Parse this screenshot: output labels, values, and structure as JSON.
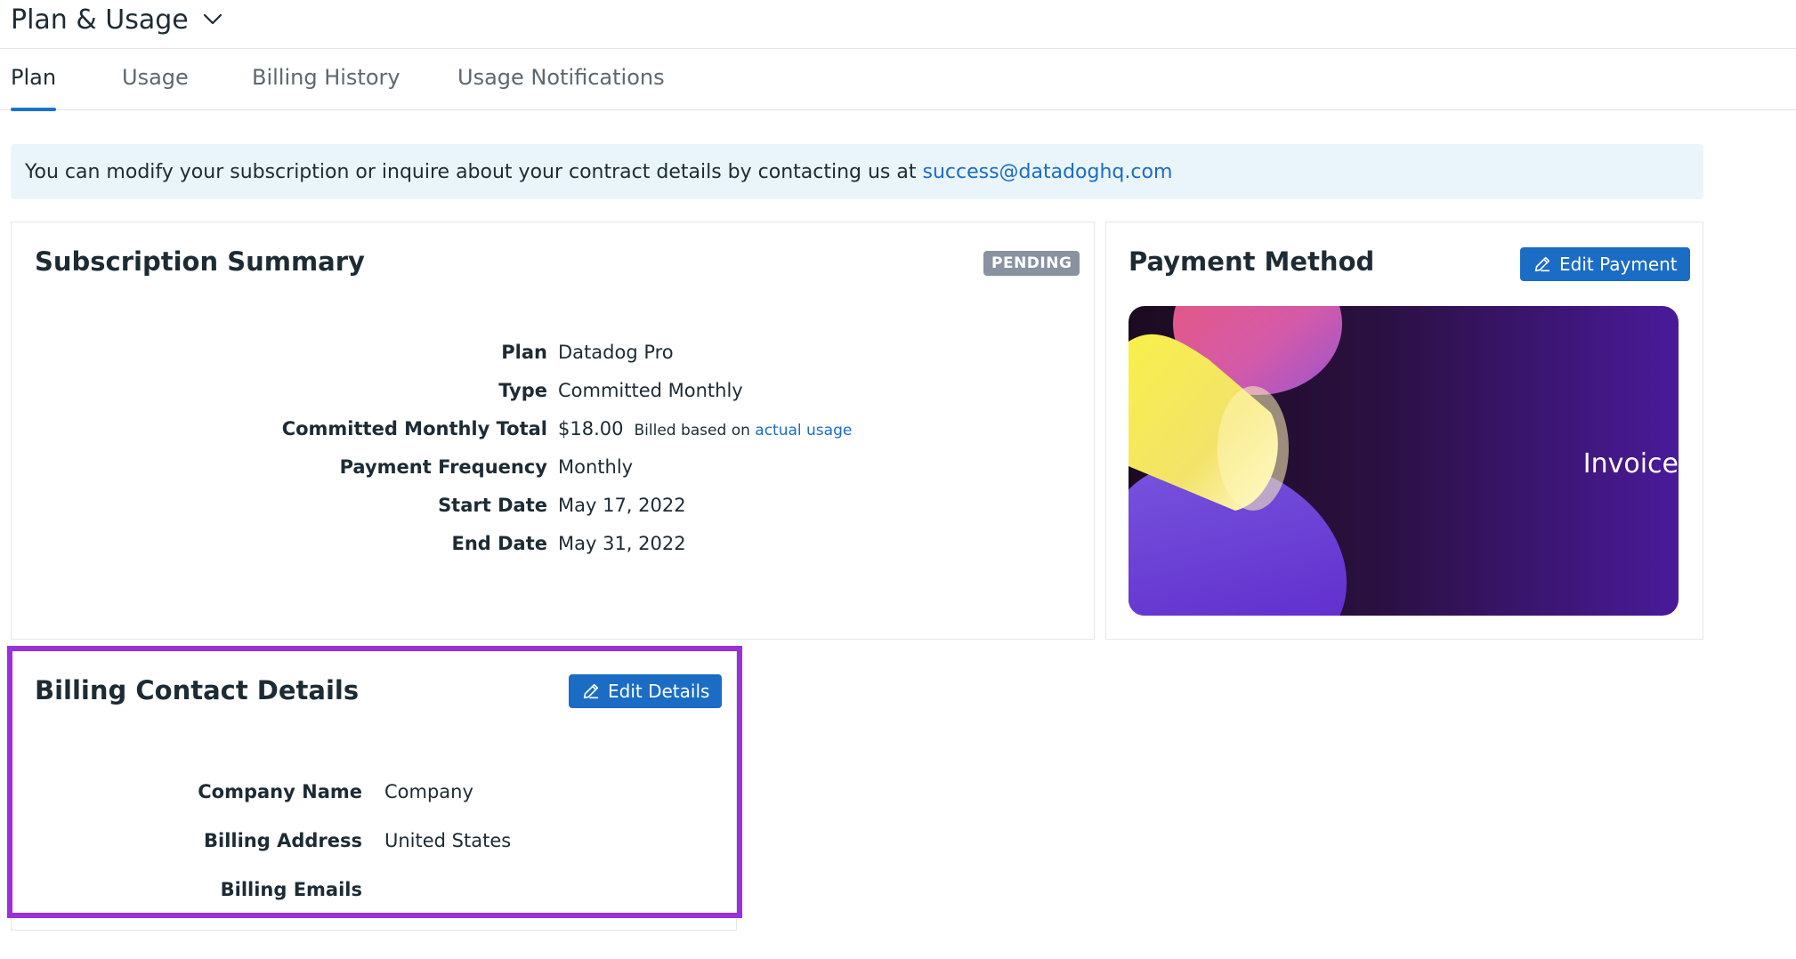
{
  "header": {
    "title": "Plan & Usage",
    "title_dropdown_icon": "chevron-down-icon"
  },
  "tabs": [
    {
      "label": "Plan",
      "active": true
    },
    {
      "label": "Usage",
      "active": false
    },
    {
      "label": "Billing History",
      "active": false
    },
    {
      "label": "Usage Notifications",
      "active": false
    }
  ],
  "banner": {
    "text": "You can modify your subscription or inquire about your contract details by contacting us at",
    "email": "success@datadoghq.com"
  },
  "subscription": {
    "title": "Subscription Summary",
    "status": "PENDING",
    "rows": [
      {
        "label": "Plan",
        "value": "Datadog Pro"
      },
      {
        "label": "Type",
        "value": "Committed Monthly"
      },
      {
        "label": "Committed Monthly Total",
        "value": "$18.00",
        "note": "Billed based on",
        "note_link": "actual usage"
      },
      {
        "label": "Payment Frequency",
        "value": "Monthly"
      },
      {
        "label": "Start Date",
        "value": "May 17, 2022"
      },
      {
        "label": "End Date",
        "value": "May 31, 2022"
      }
    ]
  },
  "payment": {
    "title": "Payment Method",
    "edit_label": "Edit Payment",
    "edit_icon": "pencil-icon",
    "card_label": "Invoice"
  },
  "billing_contact": {
    "title": "Billing Contact Details",
    "edit_label": "Edit Details",
    "edit_icon": "pencil-icon",
    "rows": [
      {
        "label": "Company Name",
        "value": "Company"
      },
      {
        "label": "Billing Address",
        "value": "United States"
      },
      {
        "label": "Billing Emails",
        "value": ""
      }
    ]
  },
  "colors": {
    "accent": "#1a6cc4",
    "highlight": "#9b30d9",
    "badge": "#8892a0",
    "banner_bg": "#eaf5fb"
  }
}
